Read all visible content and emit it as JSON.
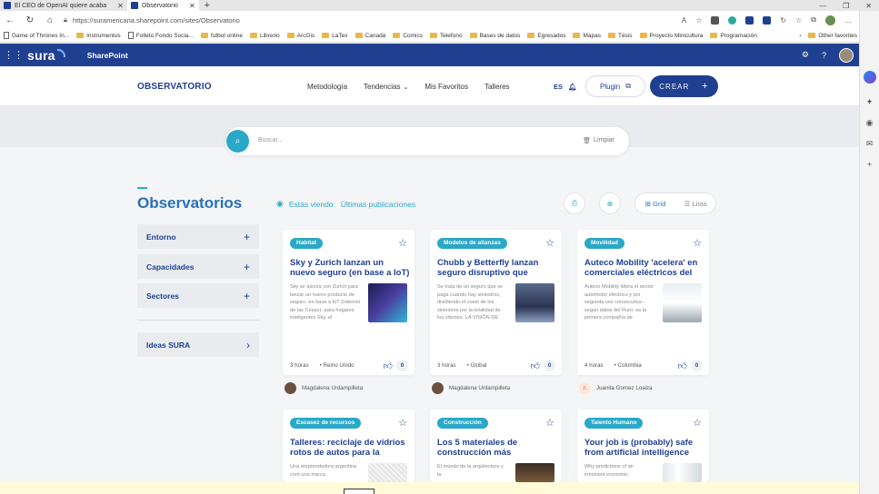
{
  "browser": {
    "tabs": [
      {
        "label": "El CEO de OpenAI quiere acaba",
        "active": false
      },
      {
        "label": "Observatorio",
        "active": true
      }
    ],
    "url": "https://suramericana.sharepoint.com/sites/Observatorio",
    "bookmarks": [
      "Game of Thrones In...",
      "Instrumentos",
      "Folleto Fondo Socia...",
      "futbol online",
      "Librerio",
      "ArcGis",
      "LaTex",
      "Canadá",
      "Comics",
      "Telefono",
      "Bases de datos",
      "Egresados",
      "Mapas",
      "Tésis",
      "Proyecto Minicultura",
      "Programación"
    ],
    "bookmarks_other": "Other favorites"
  },
  "suite": {
    "logo": "sura",
    "app_name": "SharePoint"
  },
  "site": {
    "title": "OBSERVATORIO",
    "nav": [
      "Metodología",
      "Tendencias",
      "Mis Favoritos",
      "Talleres"
    ],
    "lang": "ES",
    "plugin_label": "Plugin",
    "crear_label": "CREAR"
  },
  "search": {
    "placeholder": "Buscar...",
    "clear_label": "Limpiar"
  },
  "sidebar": {
    "title": "Observatorios",
    "sections": [
      "Entorno",
      "Capacidades",
      "Sectores"
    ],
    "ideas": "Ideas SURA"
  },
  "feed": {
    "viewing_prefix": "Estás viendo:",
    "viewing_value": "Últimas publicaciones",
    "grid_label": "Grid",
    "list_label": "Lista"
  },
  "cards": [
    {
      "tag": "Habitat",
      "title": "Sky y Zurich lanzan un nuevo seguro (en base a IoT) para",
      "desc": "Sky se asocia con Zurich para lanzar un nuevo producto de seguro -en base a IoT (Internet de las Cosas)- para hogares inteligentes Sky, el",
      "time": "3 horas",
      "region": "Reino Unido",
      "likes": "0",
      "author": "Magdalena Urdampilleta",
      "img_color": "#2a2f6e"
    },
    {
      "tag": "Modelos de alianzas",
      "title": "Chubb y Betterfly lanzan seguro disruptivo que",
      "desc": "Se trata de un seguro que se paga cuando hay siniestros, dividiendo el costo de los siniestros por la totalidad de los clientes. LA VISIÓN DE",
      "time": "3 horas",
      "region": "Global",
      "likes": "0",
      "author": "Magdalena Urdampilleta",
      "img_color": "#4a5a7a"
    },
    {
      "tag": "Movilidad",
      "title": "Auteco Mobility 'acelera' en comerciales eléctricos del",
      "desc": "Auteco Mobility lidera el sector automotor eléctrico y por segunda vez consecutiva -según datos del Runt- es la primera compañía de",
      "time": "4 horas",
      "region": "Colombia",
      "likes": "0",
      "author": "Juanita Gomez Loaiza",
      "author_initials": "JL",
      "img_color": "#c8d0d8"
    },
    {
      "tag": "Escasez de recursos",
      "title": "Talleres: reciclaje de vidrios rotos de autos para la",
      "desc": "Una emprendedora argentina creó una marca",
      "img_color": "#d8d8d8"
    },
    {
      "tag": "Construcción",
      "title": "Los 5 materiales de construcción más",
      "desc": "El mundo de la arquitectura y la",
      "img_color": "#5a4a3a"
    },
    {
      "tag": "Talento Humano",
      "title": "Your job is (probably) safe from artificial intelligence",
      "desc": "Why predictions of an imminent economic",
      "img_color": "#e0e6ea"
    }
  ],
  "colors": {
    "brand": "#1f3f91",
    "accent": "#2aa8c8"
  }
}
